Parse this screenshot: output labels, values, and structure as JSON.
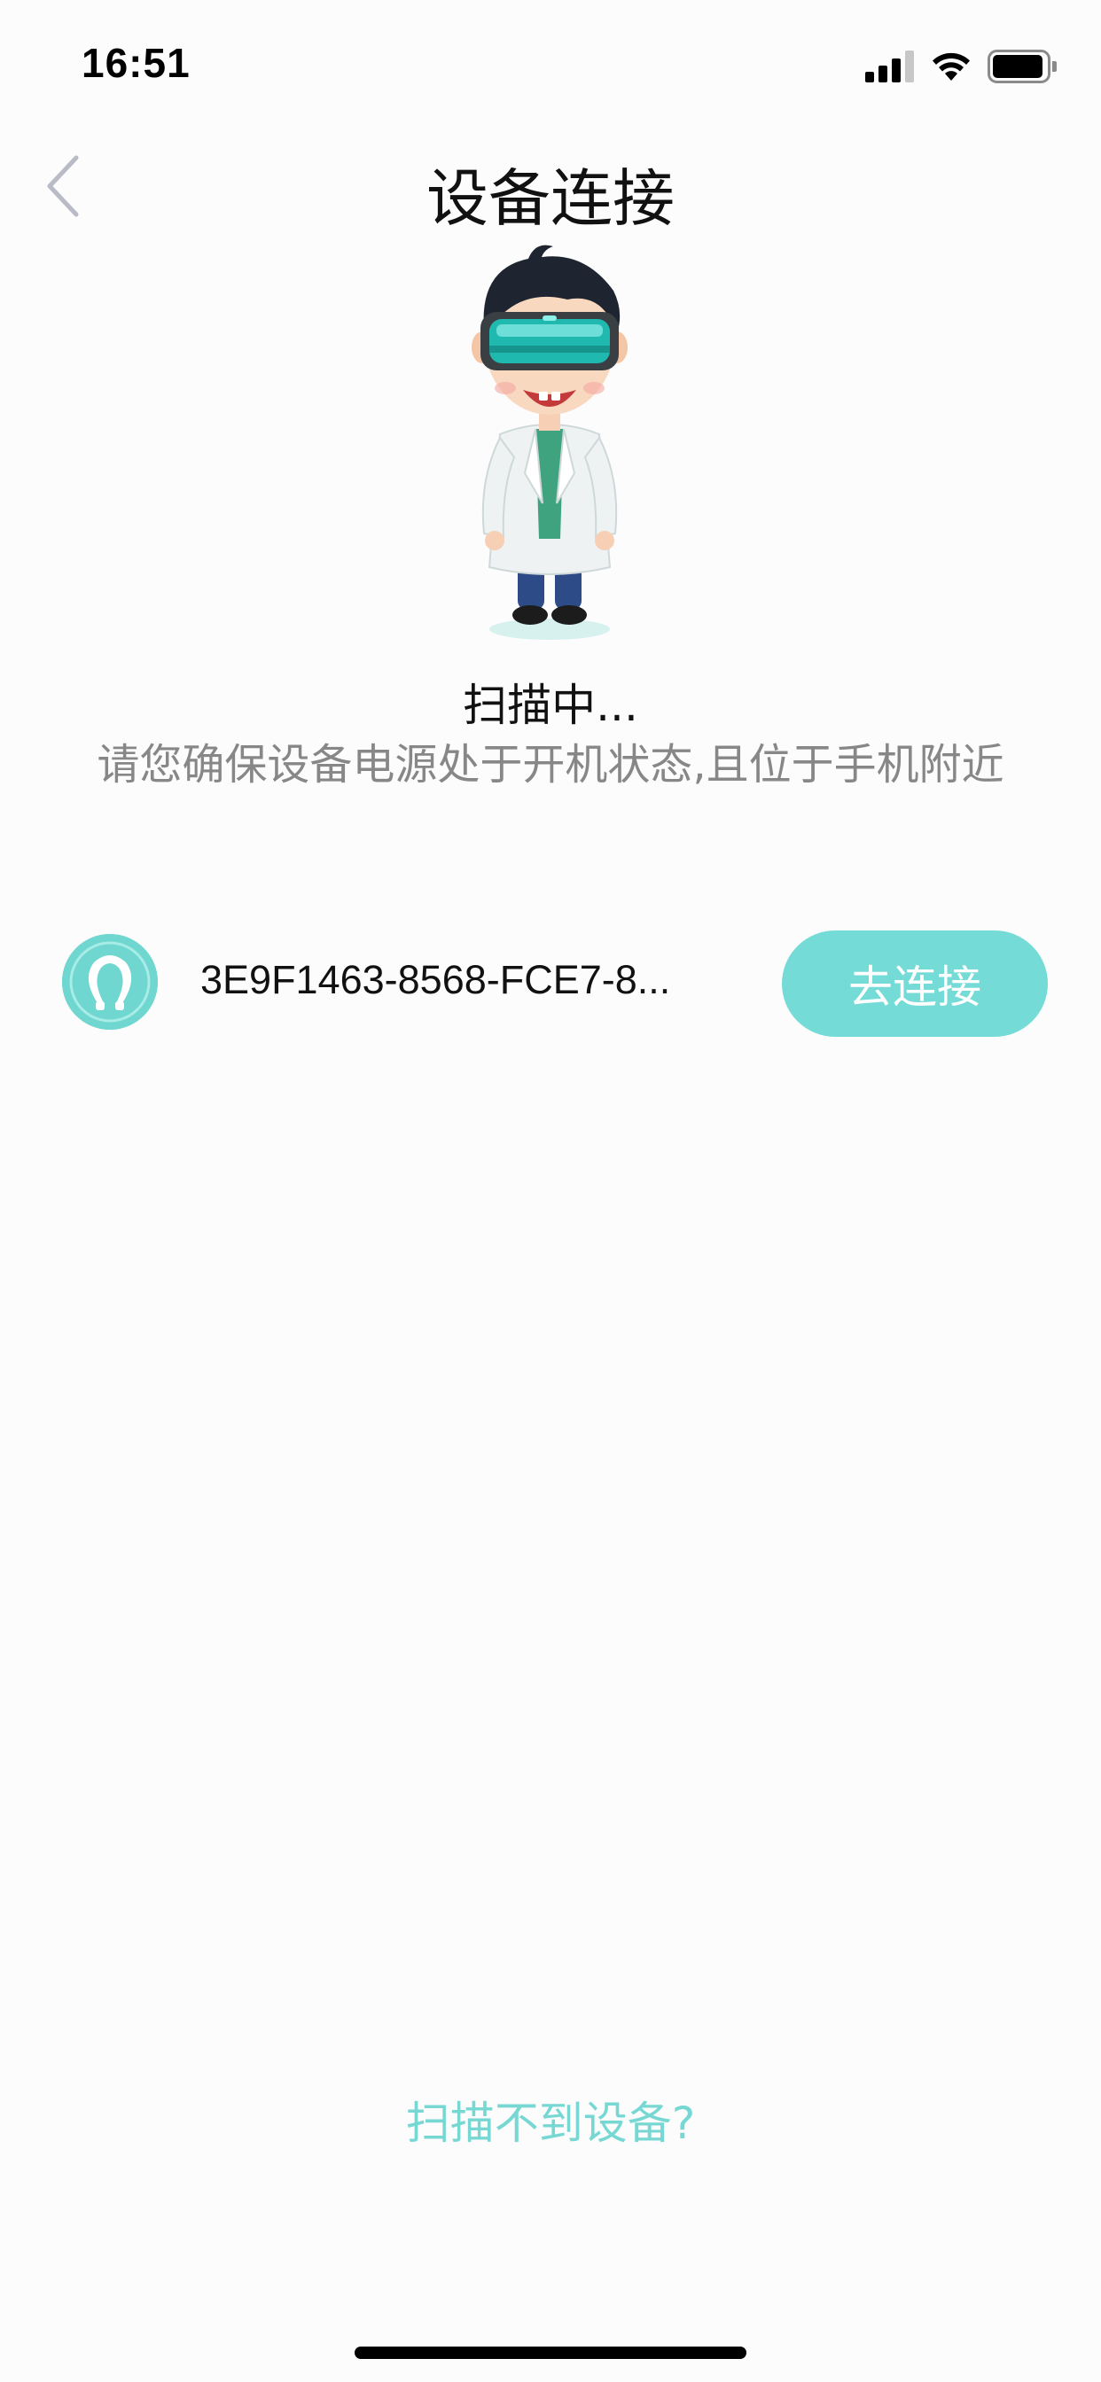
{
  "status_bar": {
    "time": "16:51"
  },
  "nav": {
    "back_icon": "chevron-left-icon",
    "title": "设备连接"
  },
  "mascot": {
    "description_icon": "vr-doctor-mascot"
  },
  "scan": {
    "status": "扫描中...",
    "hint": "请您确保设备电源处于开机状态,且位于手机附近"
  },
  "device": {
    "icon": "neck-massager-icon",
    "name": "3E9F1463-8568-FCE7-8...",
    "connect_label": "去连接"
  },
  "footer": {
    "help_link": "扫描不到设备?"
  },
  "colors": {
    "accent": "#74dbd6",
    "link": "#77d8d3",
    "hint_text": "#878787"
  }
}
